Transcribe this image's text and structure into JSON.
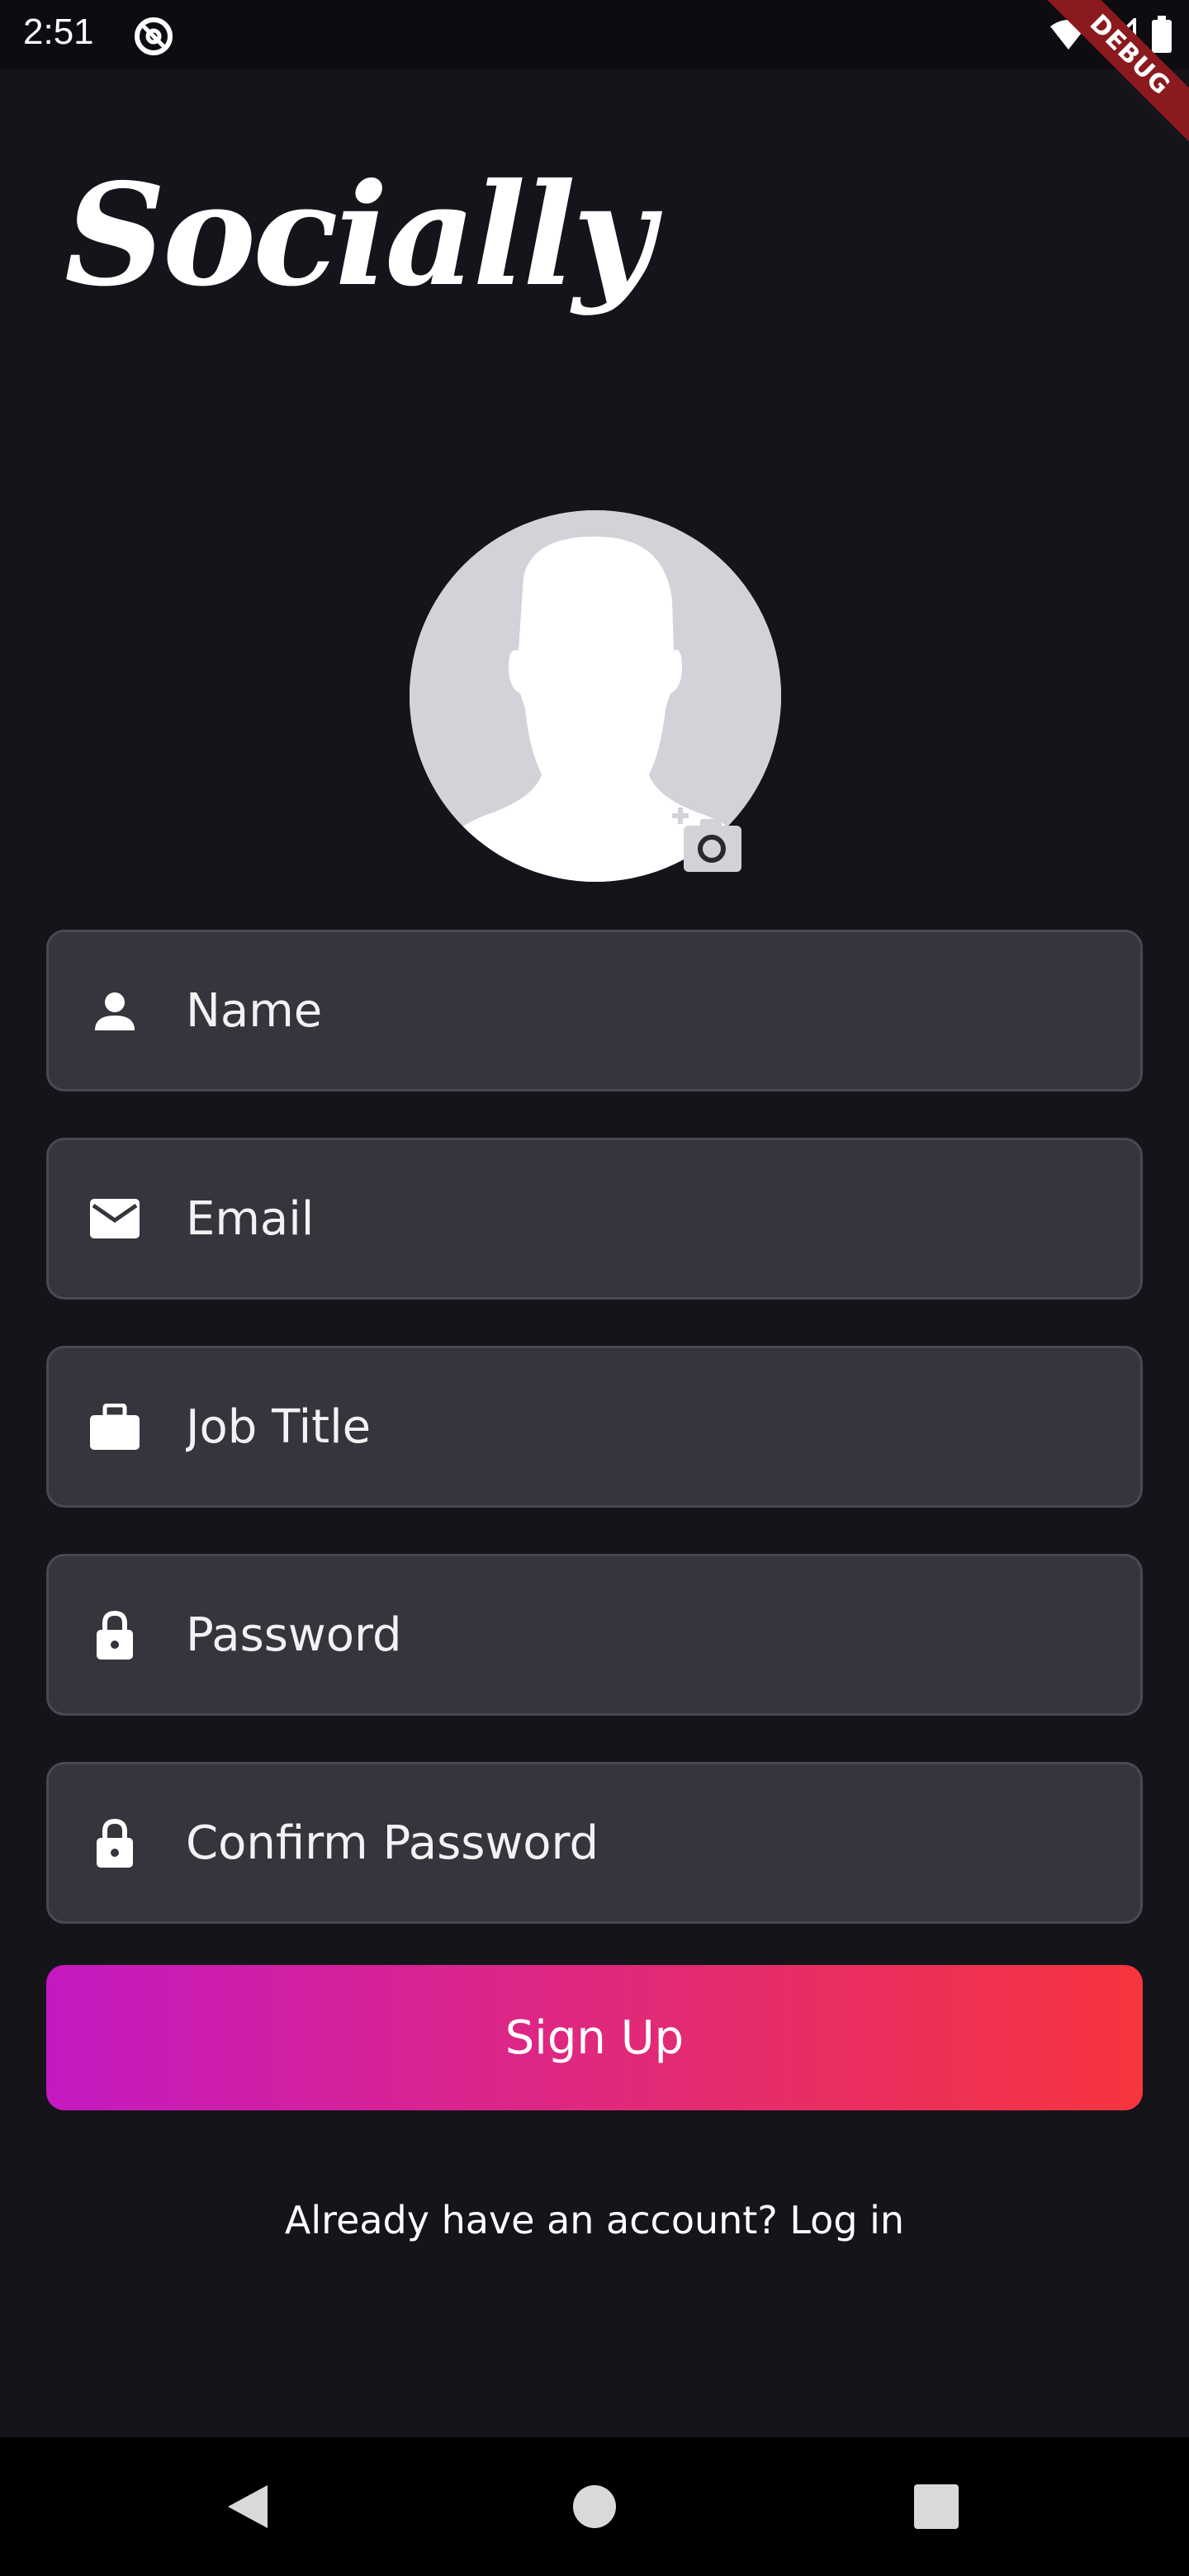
{
  "status_bar": {
    "time": "2:51",
    "icons": [
      "at-sign-icon",
      "wifi-icon",
      "signal-icon",
      "battery-icon"
    ]
  },
  "debug_banner": {
    "label": "DEBUG"
  },
  "app": {
    "logo_text": "Socially"
  },
  "avatar": {
    "icon": "default-avatar-silhouette",
    "action_icon": "add-photo-camera-icon"
  },
  "form": {
    "fields": [
      {
        "icon": "person-icon",
        "placeholder": "Name",
        "value": ""
      },
      {
        "icon": "mail-icon",
        "placeholder": "Email",
        "value": ""
      },
      {
        "icon": "briefcase-icon",
        "placeholder": "Job Title",
        "value": ""
      },
      {
        "icon": "lock-icon",
        "placeholder": "Password",
        "value": ""
      },
      {
        "icon": "lock-icon",
        "placeholder": "Confirm Password",
        "value": ""
      }
    ],
    "submit_label": "Sign Up"
  },
  "login": {
    "text": "Already have an account? Log in"
  },
  "nav_bar": {
    "buttons": [
      "back-icon",
      "home-icon",
      "recents-icon"
    ]
  },
  "colors": {
    "background": "#15141b",
    "field_bg": "#36353d",
    "gradient_start": "#c419c2",
    "gradient_end": "#f6353e"
  }
}
